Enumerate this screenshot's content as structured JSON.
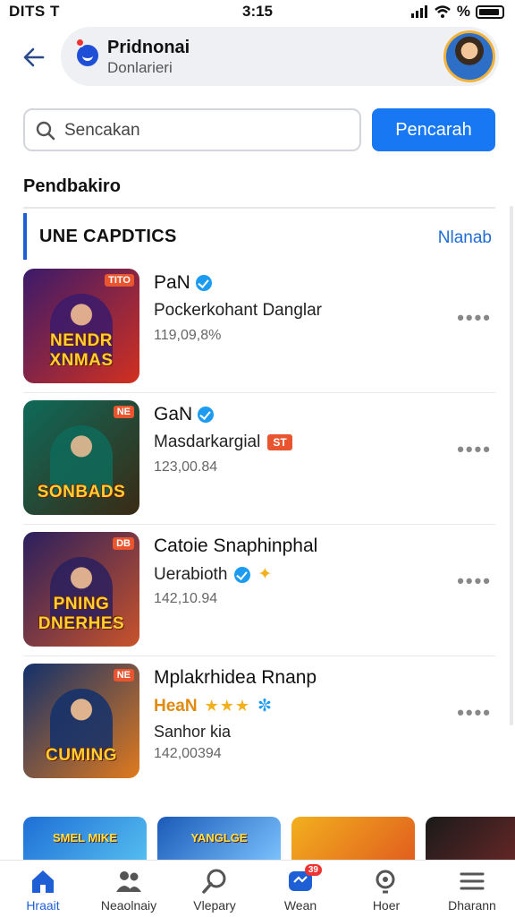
{
  "status_bar": {
    "carrier": "DITS T",
    "time": "3:15",
    "battery": "%"
  },
  "header": {
    "title": "Pridnonai",
    "subtitle": "Donlarieri"
  },
  "search": {
    "placeholder": "Sencakan",
    "button": "Pencarah"
  },
  "section": {
    "title": "Pendbakiro"
  },
  "category": {
    "label": "UNE CAPDTICS",
    "more": "Nlanab"
  },
  "items": [
    {
      "name": "PaN",
      "verified": true,
      "subtitle": "Pockerkohant Danglar",
      "count": "119,09,8%",
      "thumb_text": "NENDR XNMAS",
      "thumb_tag": "TITO",
      "colors": [
        "#3b1a6b",
        "#d2301f"
      ]
    },
    {
      "name": "GaN",
      "verified": true,
      "subtitle": "Masdarkargial",
      "badge": "ST",
      "count": "123,00.84",
      "thumb_text": "SONBADS",
      "thumb_tag": "NE",
      "colors": [
        "#0e6a5a",
        "#3a2a14"
      ]
    },
    {
      "name": "Catoie Snaphinphal",
      "verified": false,
      "subtitle": "Uerabioth",
      "count": "142,10.94",
      "thumb_text": "PNING DNERHES",
      "thumb_tag": "DB",
      "colors": [
        "#2a1f5e",
        "#c8532a"
      ]
    },
    {
      "name": "Mplakrhidea Rnanp",
      "verified": false,
      "subtitle": "HeaN",
      "stars": "★★★",
      "extra": "Sanhor kia",
      "count": "142,00394",
      "thumb_text": "CUMING",
      "thumb_tag": "NE",
      "colors": [
        "#12306b",
        "#e07a1e"
      ]
    }
  ],
  "strip": [
    {
      "text": "SMEL MIKE",
      "colors": [
        "#1e6fd6",
        "#57c1f0"
      ]
    },
    {
      "text": "YANGLGE",
      "colors": [
        "#1a5ab8",
        "#7fc6ff"
      ]
    },
    {
      "text": "",
      "colors": [
        "#f2b01e",
        "#e05a1e"
      ]
    },
    {
      "text": "",
      "colors": [
        "#1a1a1a",
        "#7a2a2a"
      ]
    }
  ],
  "nav": [
    {
      "label": "Hraait",
      "icon": "home-icon",
      "active": true
    },
    {
      "label": "Neaolnaiy",
      "icon": "people-icon"
    },
    {
      "label": "Vlepary",
      "icon": "explore-icon"
    },
    {
      "label": "Wean",
      "icon": "messages-icon",
      "badge": "39"
    },
    {
      "label": "Hoer",
      "icon": "search-icon"
    },
    {
      "label": "Dharann",
      "icon": "menu-icon"
    }
  ],
  "colors": {
    "accent": "#1877f2",
    "badge": "#e8552e"
  }
}
